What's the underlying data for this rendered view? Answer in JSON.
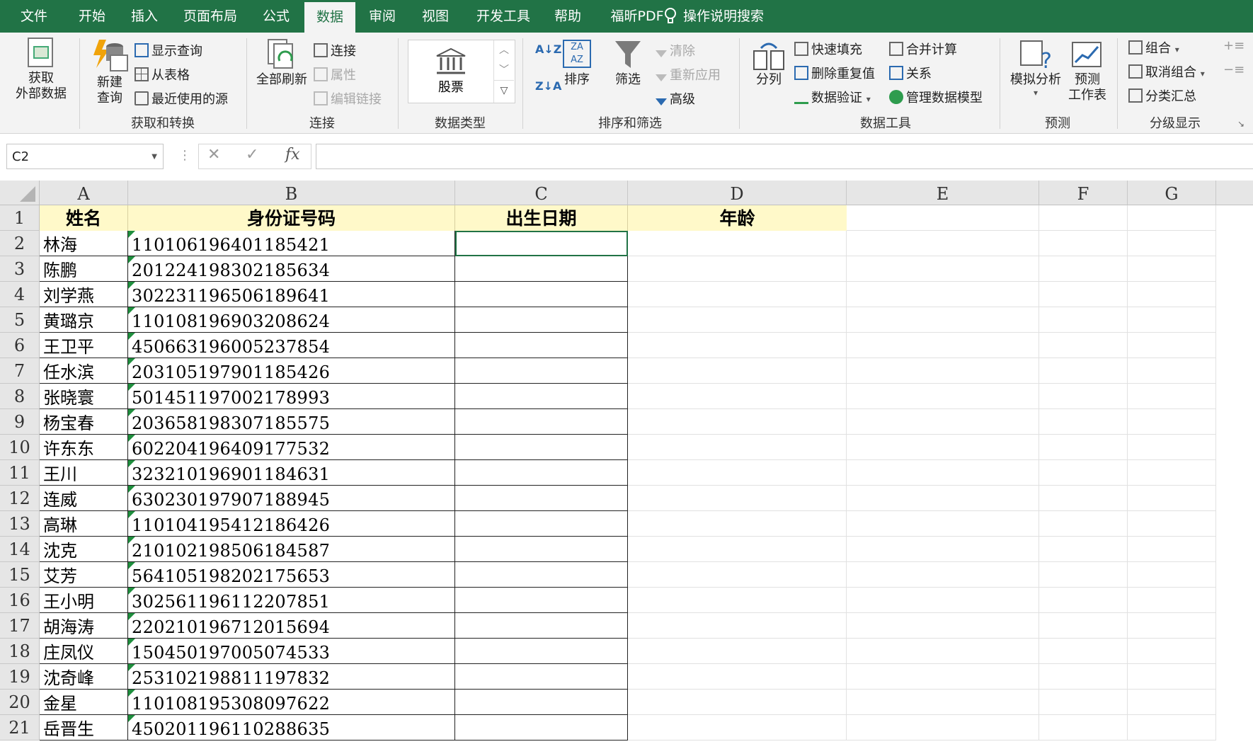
{
  "menu": {
    "tabs": [
      "文件",
      "开始",
      "插入",
      "页面布局",
      "公式",
      "数据",
      "审阅",
      "视图",
      "开发工具",
      "帮助",
      "福昕PDF"
    ],
    "active": "数据",
    "tell_me": "操作说明搜索"
  },
  "ribbon": {
    "get_external": "获取\n外部数据",
    "new_query": "新建\n查询",
    "show_query": "显示查询",
    "from_table": "从表格",
    "recent_sources": "最近使用的源",
    "group_get_transform": "获取和转换",
    "refresh_all": "全部刷新",
    "connections": "连接",
    "properties": "属性",
    "edit_links": "编辑链接",
    "group_connections": "连接",
    "stocks": "股票",
    "group_data_types": "数据类型",
    "sort": "排序",
    "filter": "筛选",
    "clear": "清除",
    "reapply": "重新应用",
    "advanced": "高级",
    "group_sort_filter": "排序和筛选",
    "text_to_columns": "分列",
    "flash_fill": "快速填充",
    "remove_duplicates": "删除重复值",
    "data_validation": "数据验证",
    "consolidate": "合并计算",
    "relationships": "关系",
    "manage_data_model": "管理数据模型",
    "group_data_tools": "数据工具",
    "what_if": "模拟分析",
    "forecast_sheet": "预测\n工作表",
    "group_forecast": "预测",
    "group": "组合",
    "ungroup": "取消组合",
    "subtotal": "分类汇总",
    "group_outline": "分级显示"
  },
  "formula_bar": {
    "name_box": "C2",
    "fx": "fx",
    "formula": ""
  },
  "columns": [
    "A",
    "B",
    "C",
    "D",
    "E",
    "F",
    "G"
  ],
  "header_row": {
    "row": "1",
    "a": "姓名",
    "b": "身份证号码",
    "c": "出生日期",
    "d": "年龄"
  },
  "rows": [
    {
      "row": "2",
      "name": "林海",
      "id": "110106196401185421"
    },
    {
      "row": "3",
      "name": "陈鹏",
      "id": "201224198302185634"
    },
    {
      "row": "4",
      "name": "刘学燕",
      "id": "302231196506189641"
    },
    {
      "row": "5",
      "name": "黄璐京",
      "id": "110108196903208624"
    },
    {
      "row": "6",
      "name": "王卫平",
      "id": "450663196005237854"
    },
    {
      "row": "7",
      "name": "任水滨",
      "id": "203105197901185426"
    },
    {
      "row": "8",
      "name": "张晓寰",
      "id": "501451197002178993"
    },
    {
      "row": "9",
      "name": "杨宝春",
      "id": "203658198307185575"
    },
    {
      "row": "10",
      "name": "许东东",
      "id": "602204196409177532"
    },
    {
      "row": "11",
      "name": "王川",
      "id": "323210196901184631"
    },
    {
      "row": "12",
      "name": "连威",
      "id": "630230197907188945"
    },
    {
      "row": "13",
      "name": "高琳",
      "id": "110104195412186426"
    },
    {
      "row": "14",
      "name": "沈克",
      "id": "210102198506184587"
    },
    {
      "row": "15",
      "name": "艾芳",
      "id": "564105198202175653"
    },
    {
      "row": "16",
      "name": "王小明",
      "id": "302561196112207851"
    },
    {
      "row": "17",
      "name": "胡海涛",
      "id": "220210196712015694"
    },
    {
      "row": "18",
      "name": "庄凤仪",
      "id": "150450197005074533"
    },
    {
      "row": "19",
      "name": "沈奇峰",
      "id": "253102198811197832"
    },
    {
      "row": "20",
      "name": "金星",
      "id": "110108195308097622"
    },
    {
      "row": "21",
      "name": "岳晋生",
      "id": "450201196110288635"
    }
  ],
  "colors": {
    "brand": "#217346",
    "header_fill": "#fff9c9",
    "text_indicator": "#1f8f3e"
  }
}
